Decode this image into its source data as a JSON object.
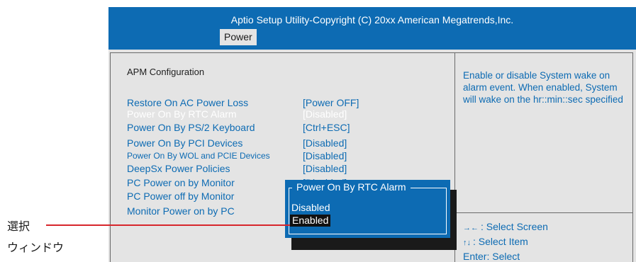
{
  "header": {
    "title": "Aptio Setup Utility-Copyright (C) 20xx American Megatrends,Inc.",
    "active_tab": "Power"
  },
  "section_title": "APM  Configuration",
  "menu": [
    {
      "label": "Restore On AC Power Loss",
      "value": "[Power OFF]",
      "selected": false
    },
    {
      "label": "Power On By RTC Alarm",
      "value": "[Disabled]",
      "selected": true
    },
    {
      "label": "Power On By PS/2 Keyboard",
      "value": "[Ctrl+ESC]",
      "selected": false
    },
    {
      "label": "Power On By PCI Devices",
      "value": "[Disabled]",
      "selected": false
    },
    {
      "label": "Power On By WOL and PCIE Devices",
      "value": "[Disabled]",
      "selected": false
    },
    {
      "label": "DeepSx Power Policies",
      "value": "[Disabled]",
      "selected": false
    },
    {
      "label": "PC Power on by Monitor",
      "value": "[Disabled]",
      "selected": false
    },
    {
      "label": "PC Power off by Monitor",
      "value": "",
      "selected": false
    },
    {
      "label": "Monitor Power on by PC",
      "value": "",
      "selected": false
    }
  ],
  "help_text": "Enable or disable System wake on alarm event. When enabled, System will wake on the hr::min::sec specified",
  "keys": [
    {
      "glyph": "→←",
      "text": ": Select Screen"
    },
    {
      "glyph": "↑↓",
      "text": ": Select Item"
    },
    {
      "glyph": "",
      "text": "Enter: Select"
    }
  ],
  "popup": {
    "title": "Power On By RTC Alarm",
    "options": [
      "Disabled",
      "Enabled"
    ],
    "selected_index": 1
  },
  "annotation": {
    "line1": "選択",
    "line2": "ウィンドウ",
    "line_color": "#d7262c"
  },
  "colors": {
    "header_bg": "#0d6bb3",
    "panel_bg": "#e4e4e4",
    "item_text": "#0d6bb3",
    "selected_text": "#ffffff"
  }
}
